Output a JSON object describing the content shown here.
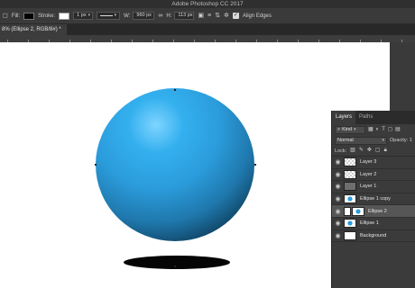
{
  "app": {
    "title": "Adobe Photoshop CC 2017"
  },
  "options_bar": {
    "fill_label": "Fill:",
    "fill_color": "#000000",
    "stroke_label": "Stroke:",
    "stroke_width": "1 px",
    "width_label": "W:",
    "width_value": "960 px",
    "height_label": "H:",
    "height_value": "113 px",
    "align_edges_label": "Align Edges",
    "align_edges_checked": true
  },
  "document": {
    "tab_title": "8% (Ellipse 2, RGB/8#) *"
  },
  "canvas": {
    "sphere_color": "#2b9cdb",
    "shadow_color": "#050505"
  },
  "layers_panel": {
    "tabs": [
      "Layers",
      "Paths"
    ],
    "kind_label": "Kind",
    "blend_mode": "Normal",
    "opacity_label": "Opacity: 1",
    "lock_label": "Lock:",
    "layers": [
      {
        "name": "Layer 3",
        "thumb": "checker",
        "selected": false
      },
      {
        "name": "Layer 2",
        "thumb": "checker",
        "selected": false
      },
      {
        "name": "Layer 1",
        "thumb": "dark",
        "selected": false
      },
      {
        "name": "Ellipse 1 copy",
        "thumb": "shape",
        "selected": false
      },
      {
        "name": "Ellipse 2",
        "thumb": "shape-link",
        "selected": true
      },
      {
        "name": "Ellipse 1",
        "thumb": "shape",
        "selected": false
      },
      {
        "name": "Background",
        "thumb": "white",
        "selected": false
      }
    ]
  }
}
